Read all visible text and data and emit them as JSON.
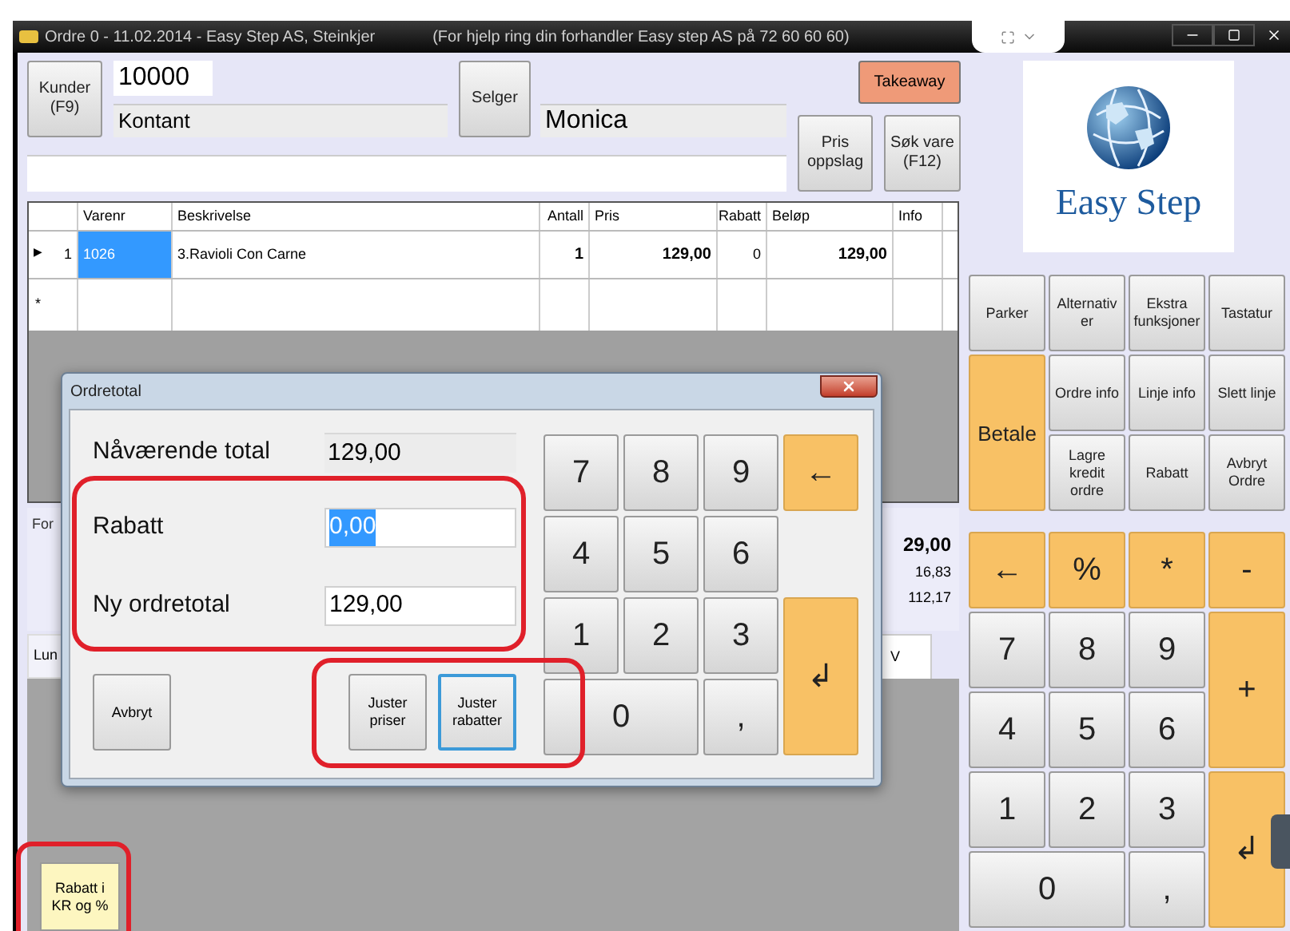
{
  "window": {
    "title": "Ordre 0 - 11.02.2014 - Easy Step AS, Steinkjer",
    "help_text": "(For hjelp ring din forhandler Easy step AS  på 72 60 60 60)"
  },
  "header": {
    "customer_button": "Kunder\n(F9)",
    "customer_number": "10000",
    "customer_name": "Kontant",
    "seller_button": "Selger",
    "seller_name": "Monica",
    "takeaway_button": "Takeaway",
    "price_lookup_button": "Pris\noppslag",
    "search_button": "Søk vare\n(F12)"
  },
  "table": {
    "columns": [
      "Varenr",
      "Beskrivelse",
      "Antall",
      "Pris",
      "Rabatt",
      "Beløp",
      "Info"
    ],
    "rows": [
      {
        "marker": "▶",
        "number": "1",
        "cells": [
          {
            "text": "1026",
            "selected": true
          },
          {
            "text": "3.Ravioli Con Carne",
            "selected": false
          },
          {
            "text": "1",
            "selected": false
          },
          {
            "text": "129,00",
            "selected": false
          },
          {
            "text": "0",
            "selected": false
          },
          {
            "text": "129,00",
            "selected": false
          }
        ]
      }
    ],
    "new_row_marker": "*"
  },
  "summary": {
    "label": "For",
    "total": "29,00",
    "lines": [
      "16,83",
      "112,17"
    ]
  },
  "tabs": [
    {
      "label": "Lun",
      "selected": false
    },
    {
      "label": "V",
      "selected": true
    }
  ],
  "quick_buttons": [
    {
      "label": "Rabatt i\nKR og %"
    }
  ],
  "logo": {
    "text": "Easy Step"
  },
  "function_buttons": [
    {
      "label": "Parker",
      "kind": "normal"
    },
    {
      "label": "Alternativ\ner",
      "kind": "normal"
    },
    {
      "label": "Ekstra\nfunksjoner",
      "kind": "normal"
    },
    {
      "label": "Tastatur",
      "kind": "normal"
    },
    {
      "label": "Betale",
      "kind": "primary"
    },
    {
      "label": "Ordre info",
      "kind": "normal"
    },
    {
      "label": "Linje info",
      "kind": "normal"
    },
    {
      "label": "Slett linje",
      "kind": "normal"
    },
    {
      "label": "Lagre\nkredit\nordre",
      "kind": "normal"
    },
    {
      "label": "Rabatt",
      "kind": "normal"
    },
    {
      "label": "Avbryt\nOrdre",
      "kind": "normal"
    }
  ],
  "keypad": [
    {
      "label": "←",
      "kind": "action"
    },
    {
      "label": "%",
      "kind": "action"
    },
    {
      "label": "*",
      "kind": "action"
    },
    {
      "label": "-",
      "kind": "action"
    },
    {
      "label": "7",
      "kind": "digit"
    },
    {
      "label": "8",
      "kind": "digit"
    },
    {
      "label": "9",
      "kind": "digit"
    },
    {
      "label": "+",
      "kind": "tall"
    },
    {
      "label": "4",
      "kind": "digit"
    },
    {
      "label": "5",
      "kind": "digit"
    },
    {
      "label": "6",
      "kind": "digit"
    },
    {
      "label": "1",
      "kind": "digit"
    },
    {
      "label": "2",
      "kind": "digit"
    },
    {
      "label": "3",
      "kind": "digit"
    },
    {
      "label": "↲",
      "kind": "tall"
    },
    {
      "label": "0",
      "kind": "wide"
    },
    {
      "label": ",",
      "kind": "digit"
    }
  ],
  "dialog": {
    "title": "Ordretotal",
    "fields": [
      {
        "label": "Nåværende total",
        "value": "129,00",
        "kind": "readonly",
        "text_selected": false
      },
      {
        "label": "Rabatt",
        "value": "0,00",
        "kind": "input",
        "text_selected": true
      },
      {
        "label": "Ny ordretotal",
        "value": "129,00",
        "kind": "input",
        "text_selected": false
      }
    ],
    "buttons": [
      {
        "label": "Avbryt",
        "focused": false
      },
      {
        "label": "Juster\npriser",
        "focused": false
      },
      {
        "label": "Juster\nrabatter",
        "focused": true
      }
    ],
    "keypad": [
      {
        "label": "7",
        "kind": "digit"
      },
      {
        "label": "8",
        "kind": "digit"
      },
      {
        "label": "9",
        "kind": "digit"
      },
      {
        "label": "←",
        "kind": "action"
      },
      {
        "label": "4",
        "kind": "digit"
      },
      {
        "label": "5",
        "kind": "digit"
      },
      {
        "label": "6",
        "kind": "digit"
      },
      {
        "kind": "blank"
      },
      {
        "label": "1",
        "kind": "digit"
      },
      {
        "label": "2",
        "kind": "digit"
      },
      {
        "label": "3",
        "kind": "digit"
      },
      {
        "label": "↲",
        "kind": "tall"
      },
      {
        "label": "0",
        "kind": "wide"
      },
      {
        "label": ",",
        "kind": "digit"
      }
    ]
  }
}
